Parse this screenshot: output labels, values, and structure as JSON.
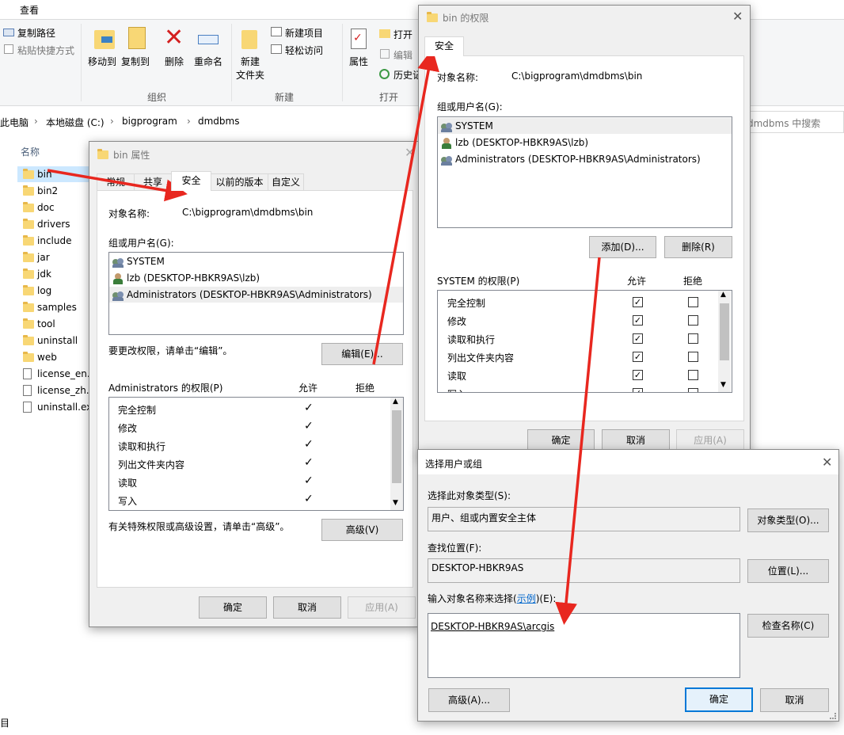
{
  "ribbon": {
    "view_tab": "查看",
    "copy_path": "复制路径",
    "paste_shortcut": "粘贴快捷方式",
    "move_to": "移动到",
    "copy_to": "复制到",
    "delete": "删除",
    "rename": "重命名",
    "new_folder_line1": "新建",
    "new_folder_line2": "文件夹",
    "new_item": "新建项目",
    "easy_access": "轻松访问",
    "properties": "属性",
    "open": "打开",
    "edit": "编辑",
    "history": "历史记",
    "group_organize": "组织",
    "group_new": "新建",
    "group_open": "打开"
  },
  "address": {
    "crumbs": [
      "此电脑",
      "本地磁盘 (C:)",
      "bigprogram",
      "dmdbms"
    ],
    "search_placeholder": "dmdbms 中搜索"
  },
  "file_list": {
    "header": "名称",
    "items": [
      "bin",
      "bin2",
      "doc",
      "drivers",
      "include",
      "jar",
      "jdk",
      "log",
      "samples",
      "tool",
      "uninstall",
      "web",
      "license_en.txt",
      "license_zh.txt",
      "uninstall.exe"
    ]
  },
  "status_bar": "目",
  "props_dialog": {
    "title": "bin 属性",
    "tabs": [
      "常规",
      "共享",
      "安全",
      "以前的版本",
      "自定义"
    ],
    "object_label": "对象名称:",
    "object_value": "C:\\bigprogram\\dmdbms\\bin",
    "groups_label": "组或用户名(G):",
    "users": [
      "SYSTEM",
      "lzb (DESKTOP-HBKR9AS\\lzb)",
      "Administrators (DESKTOP-HBKR9AS\\Administrators)"
    ],
    "change_hint": "要更改权限，请单击“编辑”。",
    "edit_button": "编辑(E)...",
    "perm_label": "Administrators 的权限(P)",
    "allow_col": "允许",
    "deny_col": "拒绝",
    "perms": [
      "完全控制",
      "修改",
      "读取和执行",
      "列出文件夹内容",
      "读取",
      "写入"
    ],
    "adv_hint": "有关特殊权限或高级设置，请单击“高级”。",
    "advanced_button": "高级(V)",
    "ok": "确定",
    "cancel": "取消",
    "apply": "应用(A)"
  },
  "perm_dialog": {
    "title": "bin 的权限",
    "tab": "安全",
    "object_label": "对象名称:",
    "object_value": "C:\\bigprogram\\dmdbms\\bin",
    "groups_label": "组或用户名(G):",
    "users": [
      "SYSTEM",
      "lzb (DESKTOP-HBKR9AS\\lzb)",
      "Administrators (DESKTOP-HBKR9AS\\Administrators)"
    ],
    "add_button": "添加(D)...",
    "remove_button": "删除(R)",
    "perm_label": "SYSTEM 的权限(P)",
    "allow_col": "允许",
    "deny_col": "拒绝",
    "perms": [
      "完全控制",
      "修改",
      "读取和执行",
      "列出文件夹内容",
      "读取",
      "写入"
    ],
    "ok": "确定",
    "cancel": "取消",
    "apply": "应用(A)"
  },
  "select_dialog": {
    "title": "选择用户或组",
    "type_label": "选择此对象类型(S):",
    "type_value": "用户、组或内置安全主体",
    "type_button": "对象类型(O)...",
    "location_label": "查找位置(F):",
    "location_value": "DESKTOP-HBKR9AS",
    "location_button": "位置(L)...",
    "enter_label_a": "输入对象名称来选择(",
    "enter_label_link": "示例",
    "enter_label_b": ")(E):",
    "name_value": "DESKTOP-HBKR9AS\\arcgis",
    "check_button": "检查名称(C)",
    "advanced_button": "高级(A)...",
    "ok": "确定",
    "cancel": "取消"
  },
  "colors": {
    "arrow": "#e8271f",
    "accent": "#0078d7"
  }
}
